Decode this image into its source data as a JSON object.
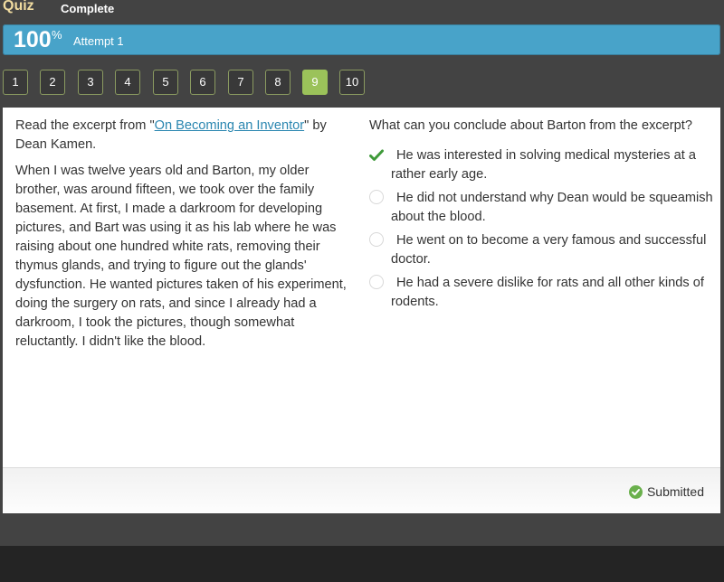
{
  "header": {
    "section": "Quiz",
    "status": "Complete"
  },
  "score": {
    "value": "100",
    "unit": "%",
    "attempt": "Attempt 1"
  },
  "navigation": {
    "questions": [
      "1",
      "2",
      "3",
      "4",
      "5",
      "6",
      "7",
      "8",
      "9",
      "10"
    ],
    "current": "9"
  },
  "passage": {
    "intro_prefix": "Read the excerpt from \"",
    "source_title": "On Becoming an Inventor",
    "intro_suffix": "\" by Dean Kamen.",
    "text": "When I was twelve years old and Barton, my older brother, was around fifteen, we took over the family basement. At first, I made a darkroom for developing pictures, and Bart was using it as his lab where he was raising about one hundred white rats, removing their thymus glands, and trying to figure out the glands' dysfunction. He wanted pictures taken of his experiment, doing the surgery on rats, and since I already had a darkroom, I took the pictures, though somewhat reluctantly. I didn't like the blood."
  },
  "question": {
    "prompt": "What can you conclude about Barton from the excerpt?",
    "options": [
      {
        "text": "He was interested in solving medical mysteries at a rather early age.",
        "state": "correct"
      },
      {
        "text": "He did not understand why Dean would be squeamish about the blood.",
        "state": "unselected"
      },
      {
        "text": "He went on to become a very famous and successful doctor.",
        "state": "unselected"
      },
      {
        "text": "He had a severe dislike for rats and all other kinds of rodents.",
        "state": "unselected"
      }
    ]
  },
  "footer": {
    "status": "Submitted"
  },
  "colors": {
    "score_bar": "#48a3c9",
    "active_question": "#9bc25a",
    "correct": "#3f9a3a",
    "submitted_icon": "#6ab04c",
    "link": "#2a86b0",
    "quiz_label": "#f1dca0"
  }
}
